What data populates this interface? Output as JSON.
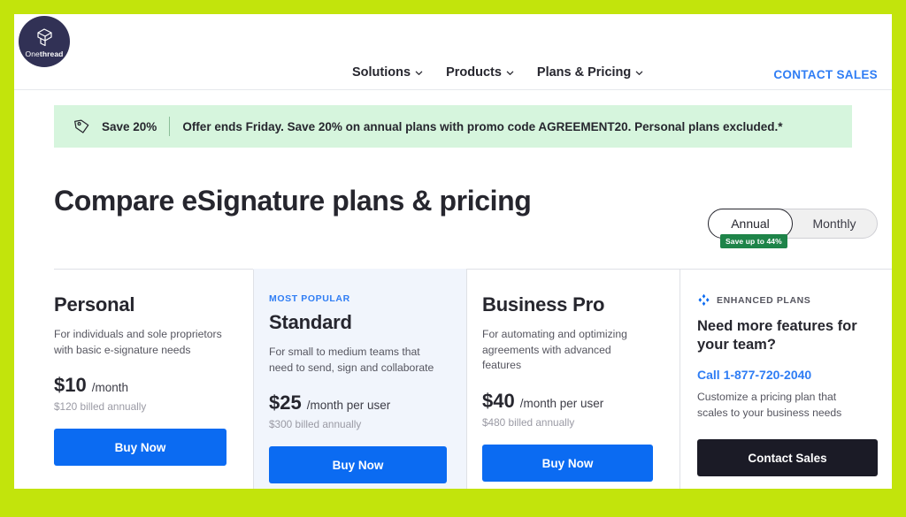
{
  "theme": {
    "page_background": "#c2e40c",
    "content_background": "#ffffff",
    "accent_blue": "#0b6bf2",
    "link_blue": "#2f7df4",
    "dark_button": "#1b1b26",
    "badge_green": "#1e8449",
    "banner_green": "#d6f5dd",
    "popular_card_bg": "#f1f5fc"
  },
  "header": {
    "logo": {
      "icon": "onethread-cube-icon",
      "name_light": "One",
      "name_bold": "thread"
    },
    "nav": [
      {
        "label": "Solutions",
        "icon": "chevron-down-icon"
      },
      {
        "label": "Products",
        "icon": "chevron-down-icon"
      },
      {
        "label": "Plans & Pricing",
        "icon": "chevron-down-icon"
      }
    ],
    "contact_sales": "CONTACT SALES"
  },
  "promo_banner": {
    "icon": "price-tag-icon",
    "label": "Save 20%",
    "message": "Offer ends Friday. Save 20% on annual plans with promo code AGREEMENT20. Personal plans excluded.*"
  },
  "page_title": "Compare eSignature plans & pricing",
  "billing_toggle": {
    "options": [
      {
        "label": "Annual",
        "selected": true
      },
      {
        "label": "Monthly",
        "selected": false
      }
    ],
    "badge": "Save up to 44%"
  },
  "plans": [
    {
      "eyebrow": "",
      "name": "Personal",
      "description": "For individuals and sole proprietors with basic e-signature needs",
      "price": "$10",
      "period": "/month",
      "billed": "$120 billed annually",
      "cta": "Buy Now"
    },
    {
      "eyebrow": "MOST POPULAR",
      "name": "Standard",
      "description": "For small to medium teams that need to send, sign and collaborate",
      "price": "$25",
      "period": "/month per user",
      "billed": "$300 billed annually",
      "cta": "Buy Now"
    },
    {
      "eyebrow": "",
      "name": "Business Pro",
      "description": "For automating and optimizing agreements with advanced features",
      "price": "$40",
      "period": "/month per user",
      "billed": "$480 billed annually",
      "cta": "Buy Now"
    }
  ],
  "enhanced": {
    "icon": "four-dots-icon",
    "eyebrow": "ENHANCED PLANS",
    "title": "Need more features for your team?",
    "phone": "Call 1-877-720-2040",
    "description": "Customize a pricing plan that scales to your business needs",
    "cta": "Contact Sales"
  }
}
